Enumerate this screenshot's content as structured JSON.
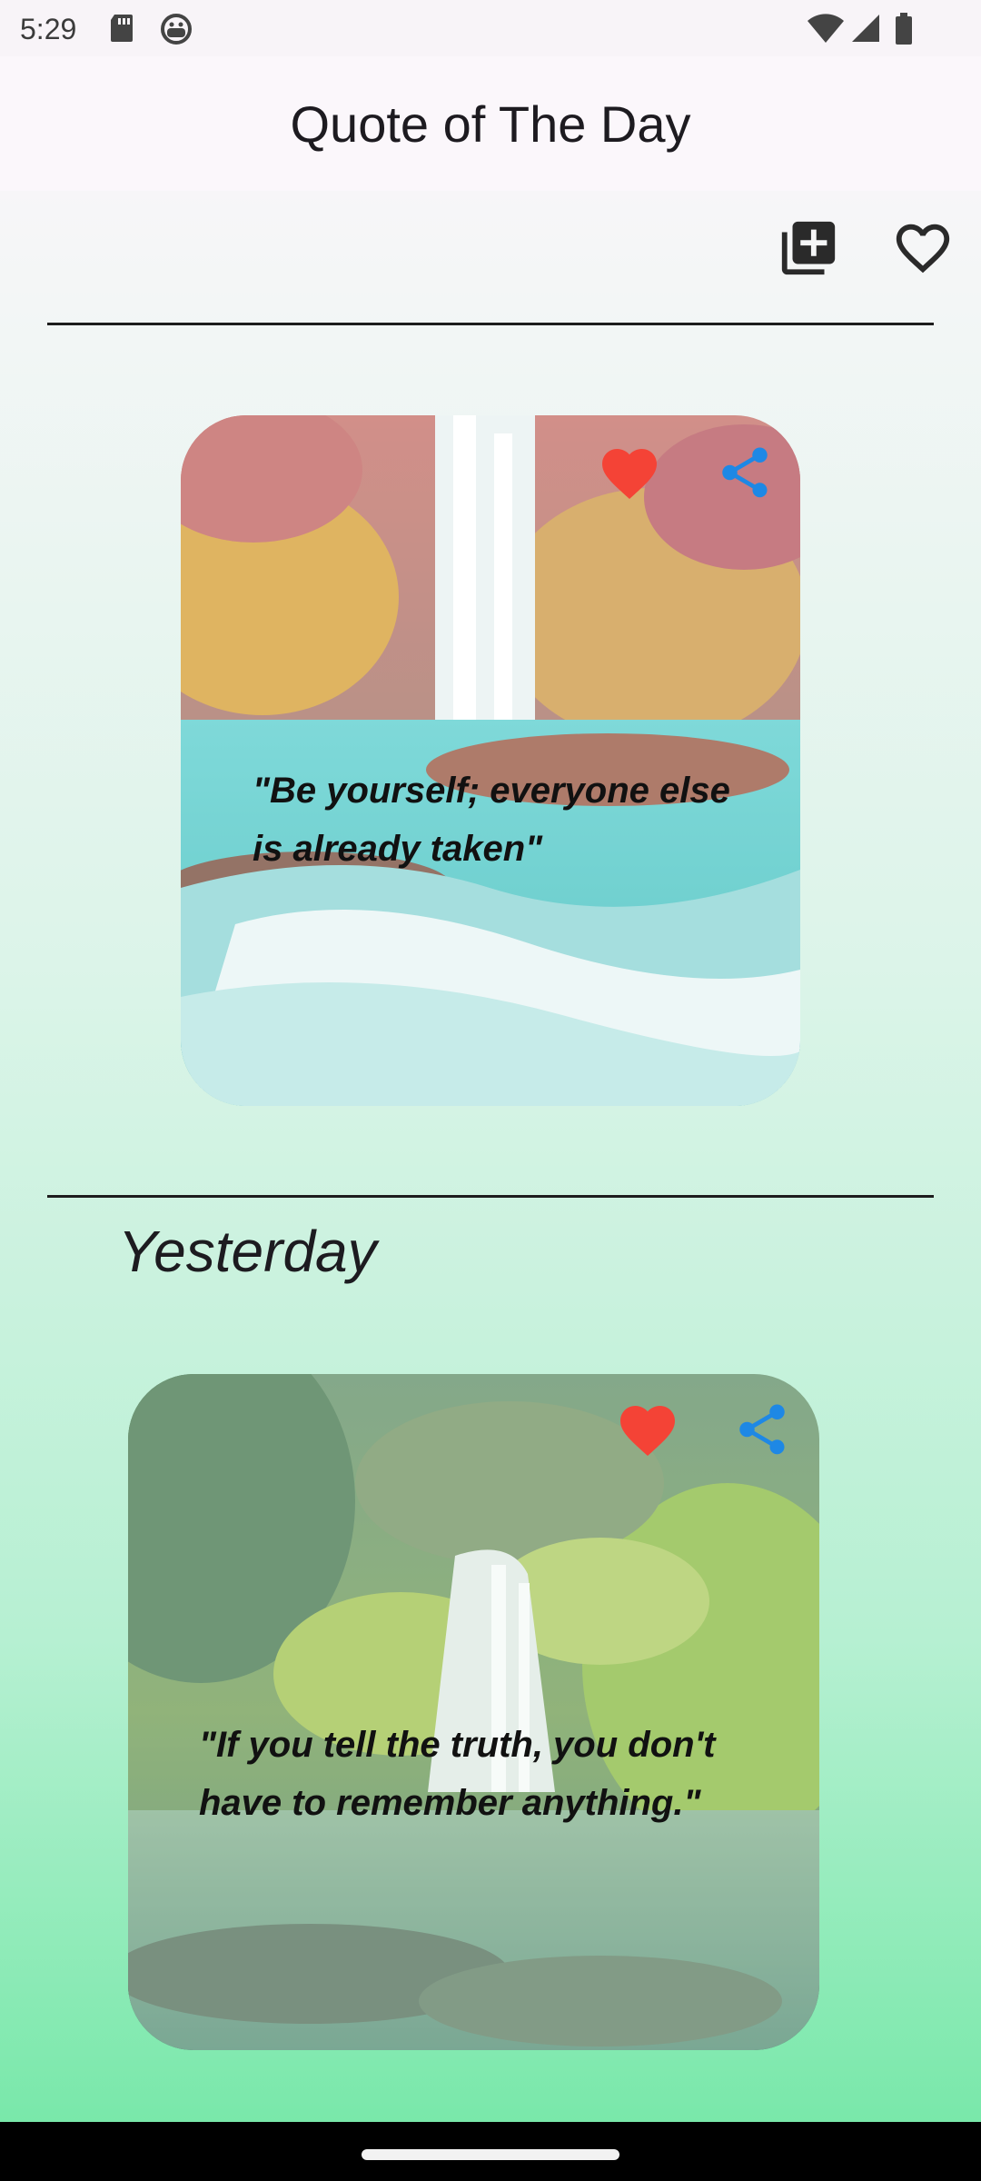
{
  "status_bar": {
    "time": "5:29",
    "left_icons": [
      "sd-card-icon",
      "android-debug-icon"
    ],
    "right_icons": [
      "wifi-icon",
      "cell-signal-icon",
      "battery-icon"
    ]
  },
  "app_bar": {
    "title": "Quote of The Day"
  },
  "toolbar": {
    "icons": [
      "add-collection-icon",
      "favorites-heart-icon"
    ]
  },
  "today": {
    "quote": "\"Be    yourself;    everyone else is already taken\"",
    "icons": [
      "favorite-heart-icon",
      "share-icon"
    ],
    "favorite_color": "#f44336",
    "share_color": "#1e88e5"
  },
  "yesterday": {
    "heading": "Yesterday",
    "quote": "\"If you tell the truth, you don't have to remember anything.\"",
    "icons": [
      "favorite-heart-icon",
      "share-icon"
    ],
    "favorite_color": "#f44336",
    "share_color": "#1e88e5"
  },
  "colors": {
    "background_top": "#f7f6f8",
    "background_bottom": "#79e8aa",
    "divider": "#1d1d1d"
  }
}
